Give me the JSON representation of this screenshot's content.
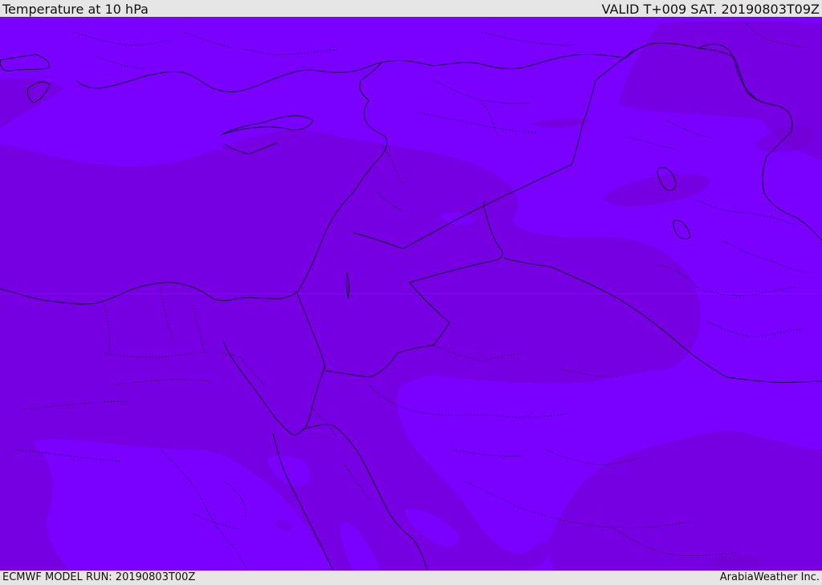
{
  "header": {
    "title": "Temperature at 10 hPa",
    "valid": "VALID T+009 SAT. 20190803T09Z"
  },
  "footer": {
    "model_run": "ECMWF MODEL RUN: 20190803T00Z",
    "credit": "ArabiaWeather Inc."
  },
  "colors": {
    "field_light": "#7a00ff",
    "field_dark": "#7600e2",
    "field_darker": "#7000d0",
    "borders": "#1a0033"
  }
}
